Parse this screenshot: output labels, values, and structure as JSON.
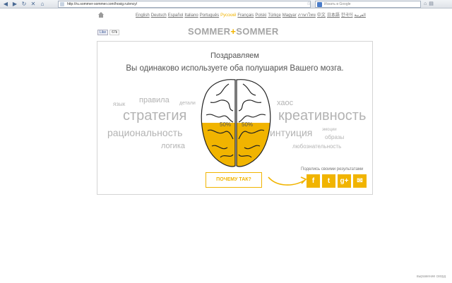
{
  "browser": {
    "url": "http://ru.sommer-sommer.com/hosig.ru/ency/",
    "search_placeholder": "Искать в Google"
  },
  "languages": [
    {
      "label": "English",
      "active": false
    },
    {
      "label": "Deutsch",
      "active": false
    },
    {
      "label": "Español",
      "active": false
    },
    {
      "label": "Italiano",
      "active": false
    },
    {
      "label": "Português",
      "active": false
    },
    {
      "label": "Русский",
      "active": true
    },
    {
      "label": "Français",
      "active": false
    },
    {
      "label": "Polski",
      "active": false
    },
    {
      "label": "Türkçe",
      "active": false
    },
    {
      "label": "Magyar",
      "active": false
    },
    {
      "label": "ภาษาไทย",
      "active": false
    },
    {
      "label": "中文",
      "active": false
    },
    {
      "label": "日本語",
      "active": false
    },
    {
      "label": "한국어",
      "active": false
    },
    {
      "label": "العربية",
      "active": false
    }
  ],
  "social": {
    "like_label": "Like",
    "like_count": "67k"
  },
  "logo": {
    "left": "SOMMER",
    "plus": "+",
    "right": "SOMMER"
  },
  "result": {
    "headline": "Поздравляем",
    "subline": "Вы одинаково используете оба полушария Вашего мозга.",
    "left_percent": "50%",
    "right_percent": "50%",
    "left_level": 0.5,
    "right_level": 0.5
  },
  "words_left": [
    "язык",
    "правила",
    "детали",
    "стратегия",
    "рациональность",
    "логика"
  ],
  "words_right": [
    "хаос",
    "креативность",
    "интуиция",
    "эмоции",
    "образы",
    "любознательность"
  ],
  "buttons": {
    "why": "ПОЧЕМУ ТАК?",
    "share_label": "Поделись своими результатами"
  },
  "share": [
    {
      "label": "f",
      "icon": "facebook-icon"
    },
    {
      "label": "t",
      "icon": "twitter-icon"
    },
    {
      "label": "g+",
      "icon": "google-plus-icon"
    },
    {
      "label": "✉",
      "icon": "mail-icon"
    }
  ],
  "footer": {
    "link": "выражение сворд"
  },
  "colors": {
    "accent": "#f1b400",
    "text": "#555555",
    "muted": "#b3b3b3"
  }
}
